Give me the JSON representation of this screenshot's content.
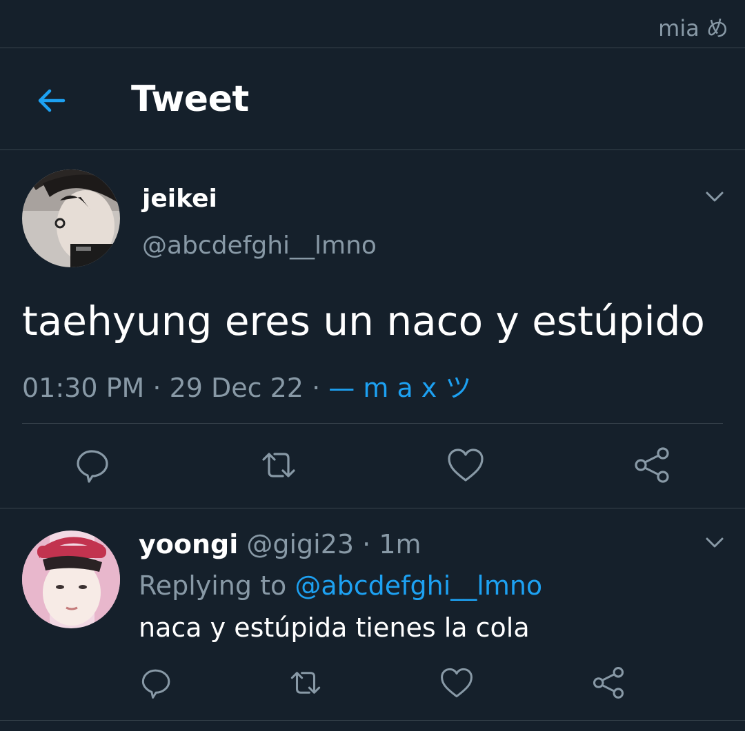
{
  "status_bar": {
    "carrier": "mia め"
  },
  "header": {
    "title": "Tweet"
  },
  "tweet": {
    "display_name": "jeikei",
    "handle": "@abcdefghi__lmno",
    "text": "taehyung eres un naco y estúpido",
    "time": "01:30 PM",
    "date": "29 Dec 22",
    "separator": "·",
    "source": "— m a x ツ"
  },
  "reply": {
    "display_name": "yoongi",
    "handle": "@gigi23",
    "separator": "·",
    "age": "1m",
    "replying_label": "Replying to",
    "replying_handle": "@abcdefghi__lmno",
    "text": "naca y estúpida tienes la cola"
  },
  "icons": {
    "back": "arrow-left-icon",
    "menu": "chevron-down-icon",
    "reply": "comment-icon",
    "retweet": "retweet-icon",
    "like": "heart-icon",
    "share": "share-icon"
  },
  "colors": {
    "background": "#15202b",
    "divider": "#38444d",
    "muted_text": "#8899a6",
    "accent": "#1da1f2",
    "text": "#ffffff"
  }
}
